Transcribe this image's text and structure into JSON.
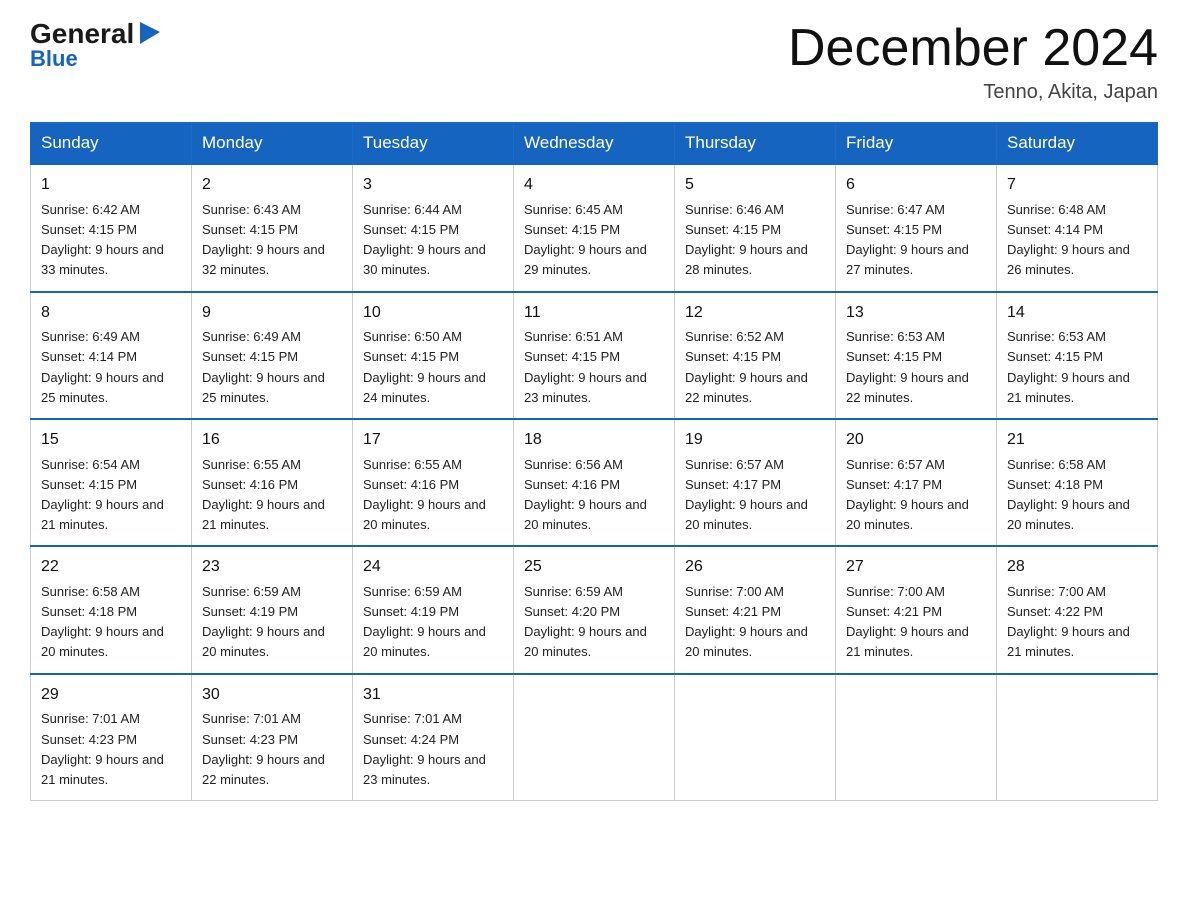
{
  "logo": {
    "general": "General",
    "arrow": "▶",
    "blue": "Blue"
  },
  "title": {
    "month": "December 2024",
    "location": "Tenno, Akita, Japan"
  },
  "weekdays": [
    "Sunday",
    "Monday",
    "Tuesday",
    "Wednesday",
    "Thursday",
    "Friday",
    "Saturday"
  ],
  "weeks": [
    [
      {
        "day": "1",
        "sunrise": "6:42 AM",
        "sunset": "4:15 PM",
        "daylight": "9 hours and 33 minutes."
      },
      {
        "day": "2",
        "sunrise": "6:43 AM",
        "sunset": "4:15 PM",
        "daylight": "9 hours and 32 minutes."
      },
      {
        "day": "3",
        "sunrise": "6:44 AM",
        "sunset": "4:15 PM",
        "daylight": "9 hours and 30 minutes."
      },
      {
        "day": "4",
        "sunrise": "6:45 AM",
        "sunset": "4:15 PM",
        "daylight": "9 hours and 29 minutes."
      },
      {
        "day": "5",
        "sunrise": "6:46 AM",
        "sunset": "4:15 PM",
        "daylight": "9 hours and 28 minutes."
      },
      {
        "day": "6",
        "sunrise": "6:47 AM",
        "sunset": "4:15 PM",
        "daylight": "9 hours and 27 minutes."
      },
      {
        "day": "7",
        "sunrise": "6:48 AM",
        "sunset": "4:14 PM",
        "daylight": "9 hours and 26 minutes."
      }
    ],
    [
      {
        "day": "8",
        "sunrise": "6:49 AM",
        "sunset": "4:14 PM",
        "daylight": "9 hours and 25 minutes."
      },
      {
        "day": "9",
        "sunrise": "6:49 AM",
        "sunset": "4:15 PM",
        "daylight": "9 hours and 25 minutes."
      },
      {
        "day": "10",
        "sunrise": "6:50 AM",
        "sunset": "4:15 PM",
        "daylight": "9 hours and 24 minutes."
      },
      {
        "day": "11",
        "sunrise": "6:51 AM",
        "sunset": "4:15 PM",
        "daylight": "9 hours and 23 minutes."
      },
      {
        "day": "12",
        "sunrise": "6:52 AM",
        "sunset": "4:15 PM",
        "daylight": "9 hours and 22 minutes."
      },
      {
        "day": "13",
        "sunrise": "6:53 AM",
        "sunset": "4:15 PM",
        "daylight": "9 hours and 22 minutes."
      },
      {
        "day": "14",
        "sunrise": "6:53 AM",
        "sunset": "4:15 PM",
        "daylight": "9 hours and 21 minutes."
      }
    ],
    [
      {
        "day": "15",
        "sunrise": "6:54 AM",
        "sunset": "4:15 PM",
        "daylight": "9 hours and 21 minutes."
      },
      {
        "day": "16",
        "sunrise": "6:55 AM",
        "sunset": "4:16 PM",
        "daylight": "9 hours and 21 minutes."
      },
      {
        "day": "17",
        "sunrise": "6:55 AM",
        "sunset": "4:16 PM",
        "daylight": "9 hours and 20 minutes."
      },
      {
        "day": "18",
        "sunrise": "6:56 AM",
        "sunset": "4:16 PM",
        "daylight": "9 hours and 20 minutes."
      },
      {
        "day": "19",
        "sunrise": "6:57 AM",
        "sunset": "4:17 PM",
        "daylight": "9 hours and 20 minutes."
      },
      {
        "day": "20",
        "sunrise": "6:57 AM",
        "sunset": "4:17 PM",
        "daylight": "9 hours and 20 minutes."
      },
      {
        "day": "21",
        "sunrise": "6:58 AM",
        "sunset": "4:18 PM",
        "daylight": "9 hours and 20 minutes."
      }
    ],
    [
      {
        "day": "22",
        "sunrise": "6:58 AM",
        "sunset": "4:18 PM",
        "daylight": "9 hours and 20 minutes."
      },
      {
        "day": "23",
        "sunrise": "6:59 AM",
        "sunset": "4:19 PM",
        "daylight": "9 hours and 20 minutes."
      },
      {
        "day": "24",
        "sunrise": "6:59 AM",
        "sunset": "4:19 PM",
        "daylight": "9 hours and 20 minutes."
      },
      {
        "day": "25",
        "sunrise": "6:59 AM",
        "sunset": "4:20 PM",
        "daylight": "9 hours and 20 minutes."
      },
      {
        "day": "26",
        "sunrise": "7:00 AM",
        "sunset": "4:21 PM",
        "daylight": "9 hours and 20 minutes."
      },
      {
        "day": "27",
        "sunrise": "7:00 AM",
        "sunset": "4:21 PM",
        "daylight": "9 hours and 21 minutes."
      },
      {
        "day": "28",
        "sunrise": "7:00 AM",
        "sunset": "4:22 PM",
        "daylight": "9 hours and 21 minutes."
      }
    ],
    [
      {
        "day": "29",
        "sunrise": "7:01 AM",
        "sunset": "4:23 PM",
        "daylight": "9 hours and 21 minutes."
      },
      {
        "day": "30",
        "sunrise": "7:01 AM",
        "sunset": "4:23 PM",
        "daylight": "9 hours and 22 minutes."
      },
      {
        "day": "31",
        "sunrise": "7:01 AM",
        "sunset": "4:24 PM",
        "daylight": "9 hours and 23 minutes."
      },
      null,
      null,
      null,
      null
    ]
  ],
  "labels": {
    "sunrise": "Sunrise: ",
    "sunset": "Sunset: ",
    "daylight": "Daylight: "
  }
}
